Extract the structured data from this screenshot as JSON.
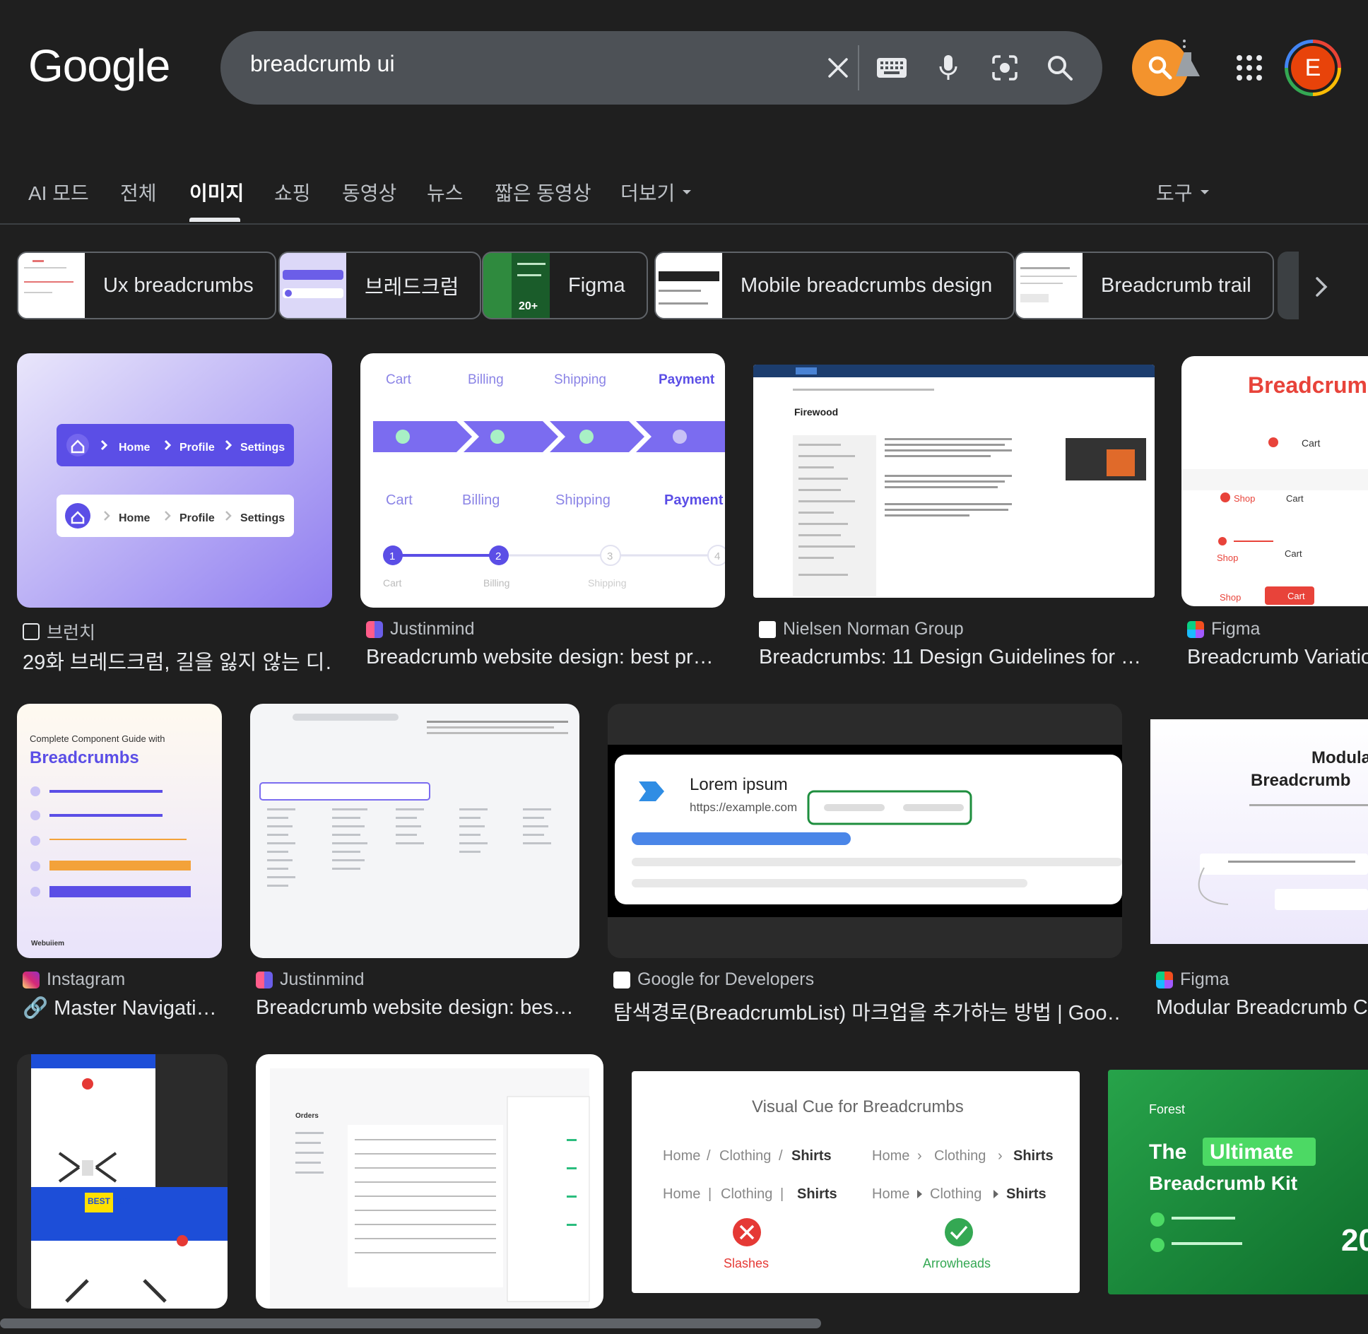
{
  "header": {
    "logo": "Google",
    "search_query": "breadcrumb ui",
    "avatar_letter": "E"
  },
  "tabs": [
    {
      "label": "AI 모드"
    },
    {
      "label": "전체"
    },
    {
      "label": "이미지",
      "active": true
    },
    {
      "label": "쇼핑"
    },
    {
      "label": "동영상"
    },
    {
      "label": "뉴스"
    },
    {
      "label": "짧은 동영상"
    },
    {
      "label": "더보기"
    }
  ],
  "tools_label": "도구",
  "chips": [
    {
      "label": "Ux breadcrumbs"
    },
    {
      "label": "브레드크럼"
    },
    {
      "label": "Figma"
    },
    {
      "label": "Mobile breadcrumbs design"
    },
    {
      "label": "Breadcrumb trail"
    }
  ],
  "results": [
    {
      "source": "브런치",
      "title": "29화 브레드크럼, 길을 잃지 않는 디…",
      "thumb_text": {
        "home": "Home",
        "profile": "Profile",
        "settings": "Settings"
      }
    },
    {
      "source": "Justinmind",
      "title": "Breadcrumb website design: best pr…",
      "thumb_text": {
        "cart": "Cart",
        "billing": "Billing",
        "shipping": "Shipping",
        "payment": "Payment",
        "step1": "1",
        "step2": "2",
        "step3": "3",
        "step4": "4"
      }
    },
    {
      "source": "Nielsen Norman Group",
      "title": "Breadcrumbs: 11 Design Guidelines for …",
      "thumb_text": {
        "heading": "Firewood"
      }
    },
    {
      "source": "Figma",
      "title": "Breadcrumb Variations",
      "thumb_text": {
        "heading": "Breadcrumb",
        "cart": "Cart",
        "shop": "Shop"
      }
    },
    {
      "source": "Instagram",
      "title": "🔗 Master Navigati…",
      "thumb_text": {
        "subtitle": "Complete Component Guide with",
        "heading": "Breadcrumbs",
        "brand": "Webuiiem"
      }
    },
    {
      "source": "Justinmind",
      "title": "Breadcrumb website design: bes…",
      "thumb_text": {}
    },
    {
      "source": "Google for Developers",
      "title": "탐색경로(BreadcrumbList) 마크업을 추가하는 방법 | Goo…",
      "thumb_text": {
        "heading": "Lorem ipsum",
        "url": "https://example.com"
      }
    },
    {
      "source": "Figma",
      "title": "Modular Breadcrumb Co…",
      "thumb_text": {
        "line1": "Modular",
        "line2": "Breadcrumb"
      }
    },
    {
      "source": "",
      "title": "",
      "thumb_text": {
        "brand": "BEST BUY"
      }
    },
    {
      "source": "",
      "title": "",
      "thumb_text": {
        "heading": "Orders"
      }
    },
    {
      "source": "",
      "title": "",
      "thumb_text": {
        "heading": "Visual Cue for Breadcrumbs",
        "home": "Home",
        "clothing": "Clothing",
        "shirts": "Shirts",
        "slashes": "Slashes",
        "arrowheads": "Arrowheads"
      }
    },
    {
      "source": "",
      "title": "",
      "thumb_text": {
        "brand": "Forest",
        "line1a": "The",
        "line1b": "Ultimate",
        "line2": "Breadcrumb Kit",
        "num": "20"
      }
    }
  ],
  "colors": {
    "background": "#1f1f1f",
    "search_bar": "#4d5156",
    "labs_orange": "#f3932d",
    "avatar": "#e8430a",
    "accent_purple": "#7b6cf0"
  }
}
